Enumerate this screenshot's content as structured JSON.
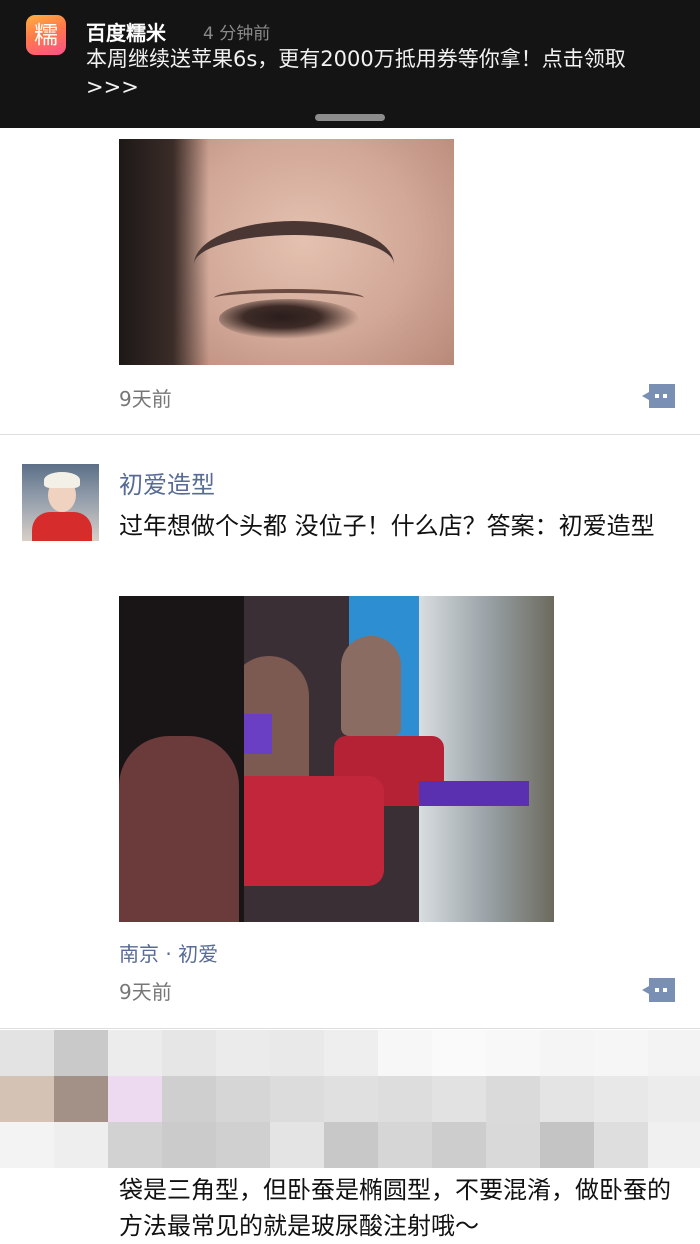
{
  "notification": {
    "app_icon_char": "糯",
    "app_icon_sub": "糯",
    "app_name": "百度糯米",
    "time": "4 分钟前",
    "message": "本周继续送苹果6s，更有2000万抵用券等你拿！点击领取>>>"
  },
  "feed": {
    "post1": {
      "time": "9天前"
    },
    "post2": {
      "author": "初爱造型",
      "text": "过年想做个头都 没位子！什么店？答案：初爱造型",
      "location": "南京 · 初爱",
      "time": "9天前"
    },
    "post3": {
      "text_fragment": "袋是三角型，但卧蚕是椭圆型，不要混淆，做卧蚕的方法最常见的就是玻尿酸注射哦～"
    }
  },
  "colors": {
    "link_blue": "#576b95",
    "banner_bg": "#141414",
    "comment_icon": "#7a8fb4"
  },
  "icons": {
    "comment": "comment-bubble-icon",
    "app": "nuomi-app-icon"
  }
}
